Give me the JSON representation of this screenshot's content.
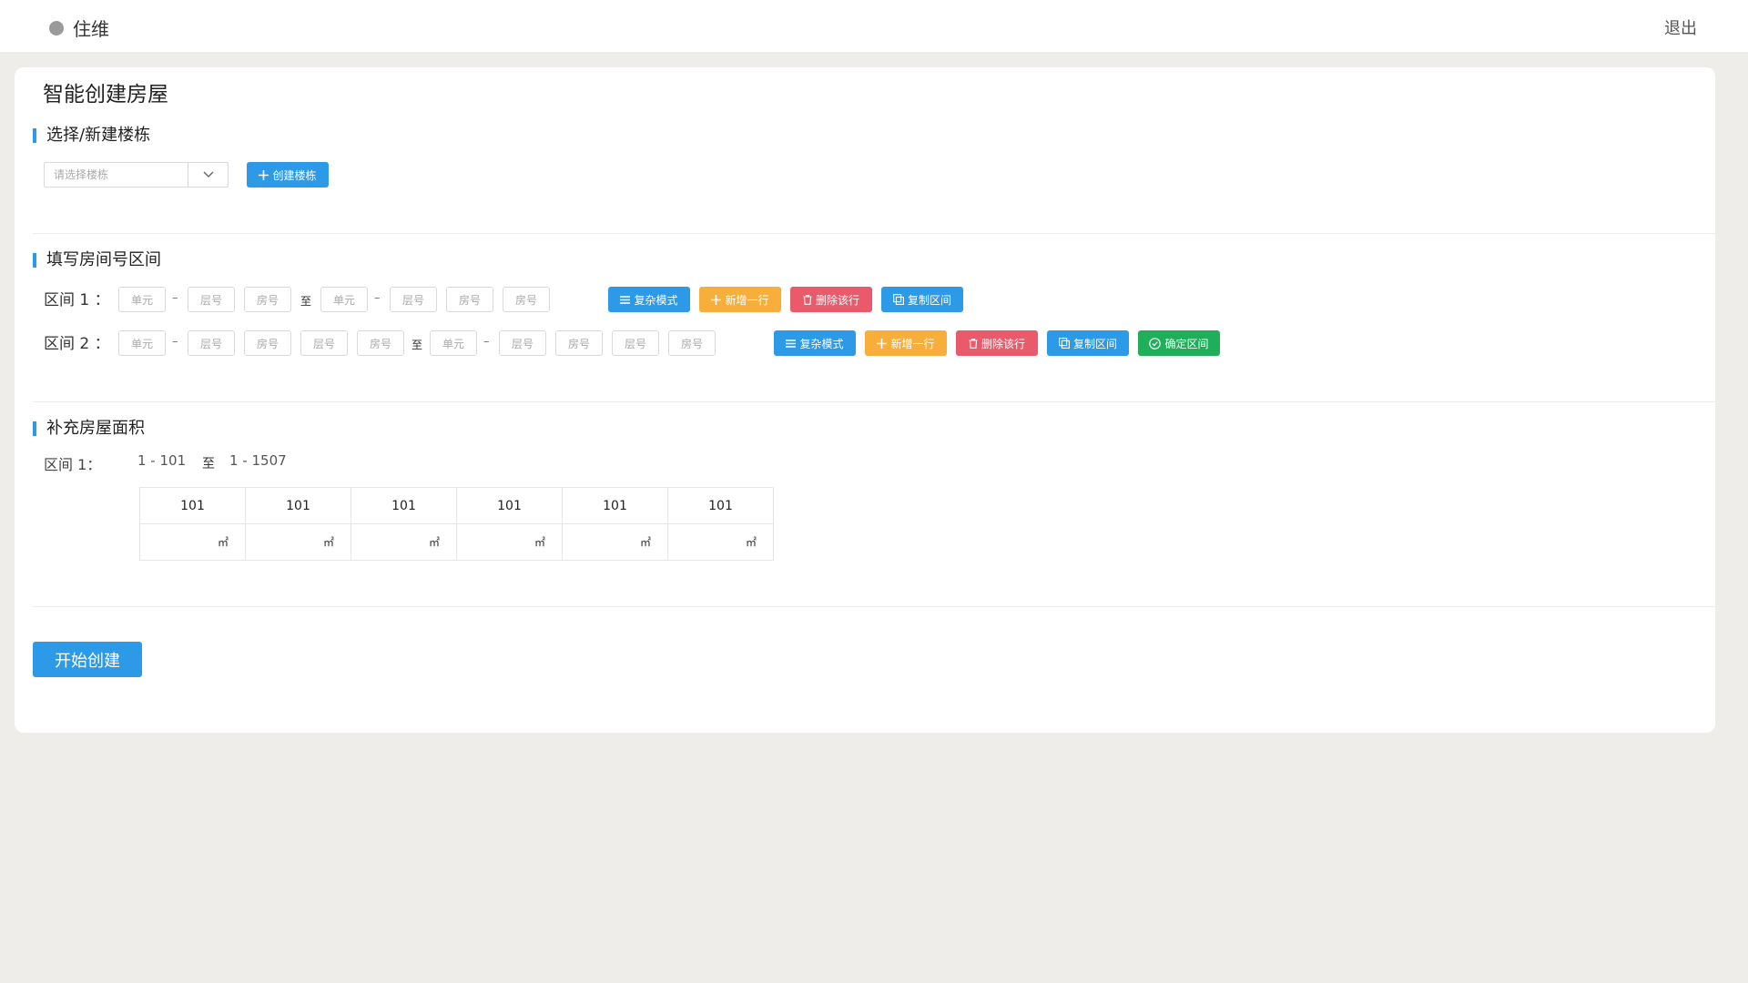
{
  "header": {
    "brand": "住维",
    "logout": "退出"
  },
  "page_title": "智能创建房屋",
  "building_section": {
    "title": "选择/新建楼栋",
    "select_placeholder": "请选择楼栋",
    "create_button": "创建楼栋"
  },
  "range_section": {
    "title": "填写房间号区间",
    "ranges": [
      {
        "label": "区间 1 ：",
        "from_fields": [
          "单元",
          "层号",
          "房号"
        ],
        "to_word": "至",
        "to_fields": [
          "单元",
          "层号",
          "房号",
          "房号"
        ],
        "buttons": {
          "complex": "复杂模式",
          "add_row": "新增一行",
          "delete_row": "删除该行",
          "copy": "复制区间"
        }
      },
      {
        "label": "区间 2 ：",
        "from_fields": [
          "单元",
          "层号",
          "房号",
          "层号",
          "房号"
        ],
        "to_word": "至",
        "to_fields": [
          "单元",
          "层号",
          "房号",
          "层号",
          "房号"
        ],
        "buttons": {
          "complex": "复杂模式",
          "add_row": "新增一行",
          "delete_row": "删除该行",
          "copy": "复制区间",
          "confirm": "确定区间"
        }
      }
    ]
  },
  "area_section": {
    "title": "补充房屋面积",
    "range_label": "区间 1：",
    "range_from": "1 - 101",
    "range_to_word": "至",
    "range_to": "1 - 1507",
    "rooms": [
      "101",
      "101",
      "101",
      "101",
      "101",
      "101"
    ],
    "unit": "㎡"
  },
  "start_button": "开始创建",
  "colors": {
    "primary": "#2d9ae8",
    "warning": "#f7ae3b",
    "danger": "#e95a6b",
    "success": "#1fae5a"
  }
}
